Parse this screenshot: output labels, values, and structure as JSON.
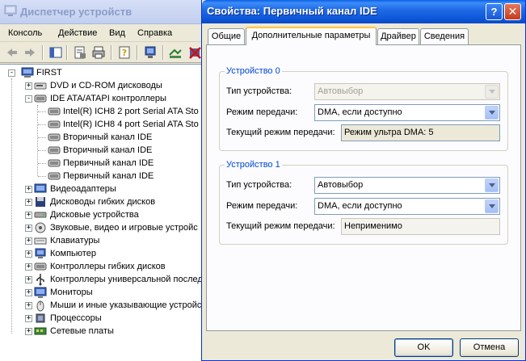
{
  "device_manager": {
    "title": "Диспетчер устройств",
    "menu": [
      "Консоль",
      "Действие",
      "Вид",
      "Справка"
    ],
    "toolbar_icons": [
      "back-icon",
      "forward-icon",
      "console-tree-icon",
      "properties-icon",
      "print-icon",
      "help-icon",
      "scan-hardware-icon",
      "update-driver-icon",
      "uninstall-icon"
    ],
    "tree": {
      "root": "FIRST",
      "items": [
        {
          "label": "DVD и CD-ROM дисководы",
          "icon": "dvd-drive-icon",
          "expander": "+"
        },
        {
          "label": "IDE ATA/ATAPI контроллеры",
          "icon": "ide-controller-icon",
          "expander": "-",
          "children": [
            "Intel(R) ICH8 2 port Serial ATA Sto",
            "Intel(R) ICH8 4 port Serial ATA Sto",
            "Вторичный канал IDE",
            "Вторичный канал IDE",
            "Первичный канал IDE",
            "Первичный канал IDE"
          ]
        },
        {
          "label": "Видеоадаптеры",
          "icon": "display-adapter-icon",
          "expander": "+"
        },
        {
          "label": "Дисководы гибких дисков",
          "icon": "floppy-drive-icon",
          "expander": "+"
        },
        {
          "label": "Дисковые устройства",
          "icon": "disk-drive-icon",
          "expander": "+"
        },
        {
          "label": "Звуковые, видео и игровые устройс",
          "icon": "sound-icon",
          "expander": "+"
        },
        {
          "label": "Клавиатуры",
          "icon": "keyboard-icon",
          "expander": "+"
        },
        {
          "label": "Компьютер",
          "icon": "computer-icon",
          "expander": "+"
        },
        {
          "label": "Контроллеры гибких дисков",
          "icon": "floppy-controller-icon",
          "expander": "+"
        },
        {
          "label": "Контроллеры универсальной послед",
          "icon": "usb-controller-icon",
          "expander": "+"
        },
        {
          "label": "Мониторы",
          "icon": "monitor-icon",
          "expander": "+"
        },
        {
          "label": "Мыши и иные указывающие устройс",
          "icon": "mouse-icon",
          "expander": "+"
        },
        {
          "label": "Процессоры",
          "icon": "processor-icon",
          "expander": "+"
        },
        {
          "label": "Сетевые платы",
          "icon": "network-adapter-icon",
          "expander": "+"
        }
      ]
    }
  },
  "dialog": {
    "title": "Свойства: Первичный канал IDE",
    "help_glyph": "?",
    "close_glyph": "✕",
    "tabs": [
      {
        "label": "Общие",
        "active": false
      },
      {
        "label": "Дополнительные параметры",
        "active": true
      },
      {
        "label": "Драйвер",
        "active": false
      },
      {
        "label": "Сведения",
        "active": false
      }
    ],
    "device0": {
      "legend": "Устройство 0",
      "type_label": "Тип устройства:",
      "type_value": "Автовыбор",
      "mode_label": "Режим передачи:",
      "mode_value": "DMA, если доступно",
      "current_label": "Текущий режим передачи:",
      "current_value": "Режим ультра DMA: 5"
    },
    "device1": {
      "legend": "Устройство 1",
      "type_label": "Тип устройства:",
      "type_value": "Автовыбор",
      "mode_label": "Режим передачи:",
      "mode_value": "DMA, если доступно",
      "current_label": "Текущий режим передачи:",
      "current_value": "Неприменимо"
    },
    "ok_label": "OK",
    "cancel_label": "Отмена"
  },
  "colors": {
    "titlebar_blue": "#0b54d6",
    "legend_blue": "#0046d5",
    "active_tab_accent": "#ffc83c"
  }
}
